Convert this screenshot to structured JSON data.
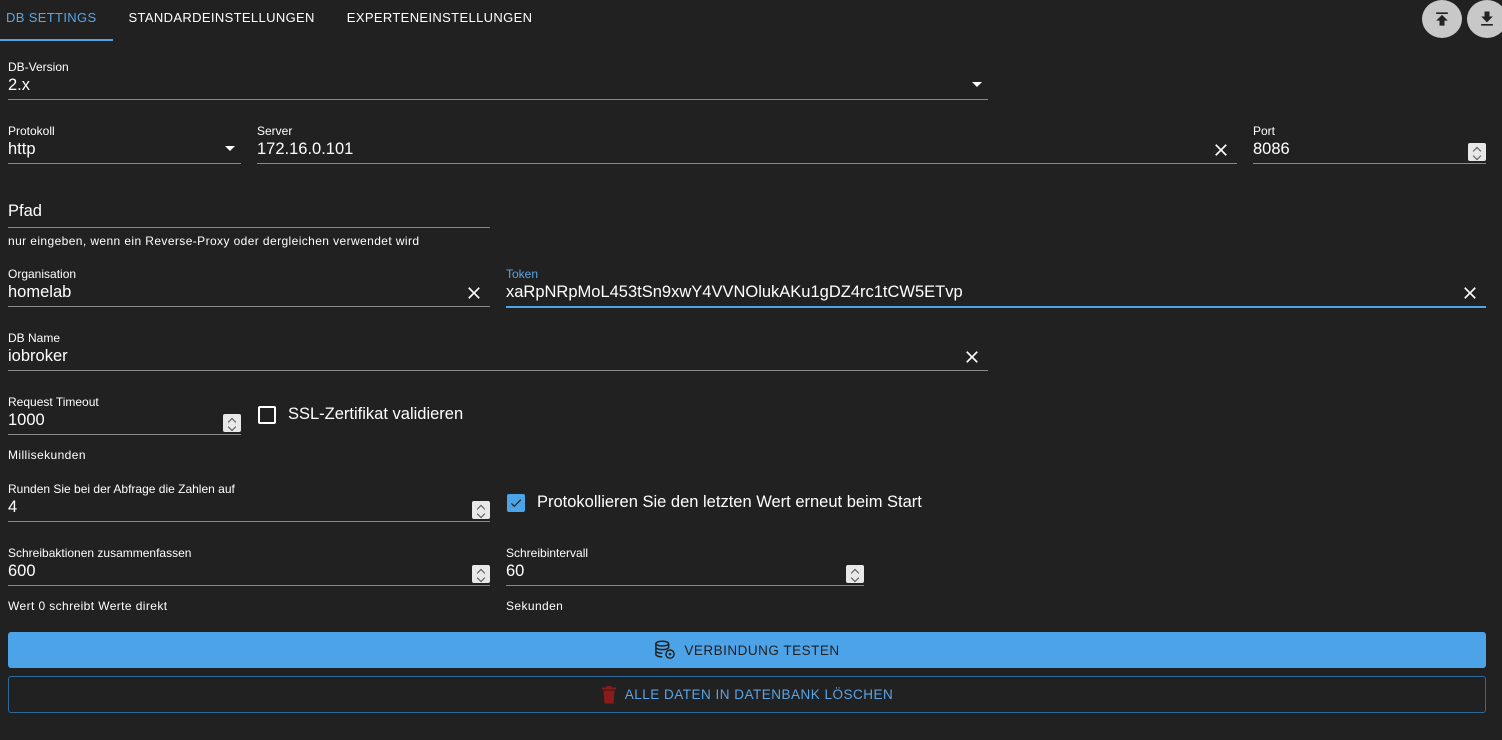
{
  "tabs": [
    {
      "label": "DB SETTINGS",
      "active": true
    },
    {
      "label": "STANDARDEINSTELLUNGEN",
      "active": false
    },
    {
      "label": "EXPERTENEINSTELLUNGEN",
      "active": false
    }
  ],
  "toolbar": {
    "upload_icon": "upload-to-top-icon",
    "download_icon": "download-icon"
  },
  "db_version": {
    "label": "DB-Version",
    "value": "2.x"
  },
  "protocol": {
    "label": "Protokoll",
    "value": "http"
  },
  "server": {
    "label": "Server",
    "value": "172.16.0.101"
  },
  "port": {
    "label": "Port",
    "value": "8086"
  },
  "path": {
    "placeholder": "Pfad",
    "helper": "nur eingeben, wenn ein Reverse-Proxy oder dergleichen verwendet wird"
  },
  "organisation": {
    "label": "Organisation",
    "value": "homelab"
  },
  "token": {
    "label": "Token",
    "value": "xaRpNRpMoL453tSn9xwY4VVNOlukAKu1gDZ4rc1tCW5ETvp"
  },
  "db_name": {
    "label": "DB Name",
    "value": "iobroker"
  },
  "request_timeout": {
    "label": "Request Timeout",
    "value": "1000",
    "helper": "Millisekunden"
  },
  "ssl_validate": {
    "label": "SSL-Zertifikat validieren",
    "checked": false
  },
  "round": {
    "label": "Runden Sie bei der Abfrage die Zahlen auf",
    "value": "4"
  },
  "log_last_value": {
    "label": "Protokollieren Sie den letzten Wert erneut beim Start",
    "checked": true
  },
  "batch_writes": {
    "label": "Schreibaktionen zusammenfassen",
    "value": "600",
    "helper": "Wert 0 schreibt Werte direkt"
  },
  "write_interval": {
    "label": "Schreibintervall",
    "value": "60",
    "helper": "Sekunden"
  },
  "buttons": {
    "test_connection": "VERBINDUNG TESTEN",
    "delete_all": "ALLE DATEN IN DATENBANK LÖSCHEN"
  },
  "colors": {
    "accent": "#4da3e8",
    "background": "#212121",
    "danger": "#8b1a1a"
  }
}
